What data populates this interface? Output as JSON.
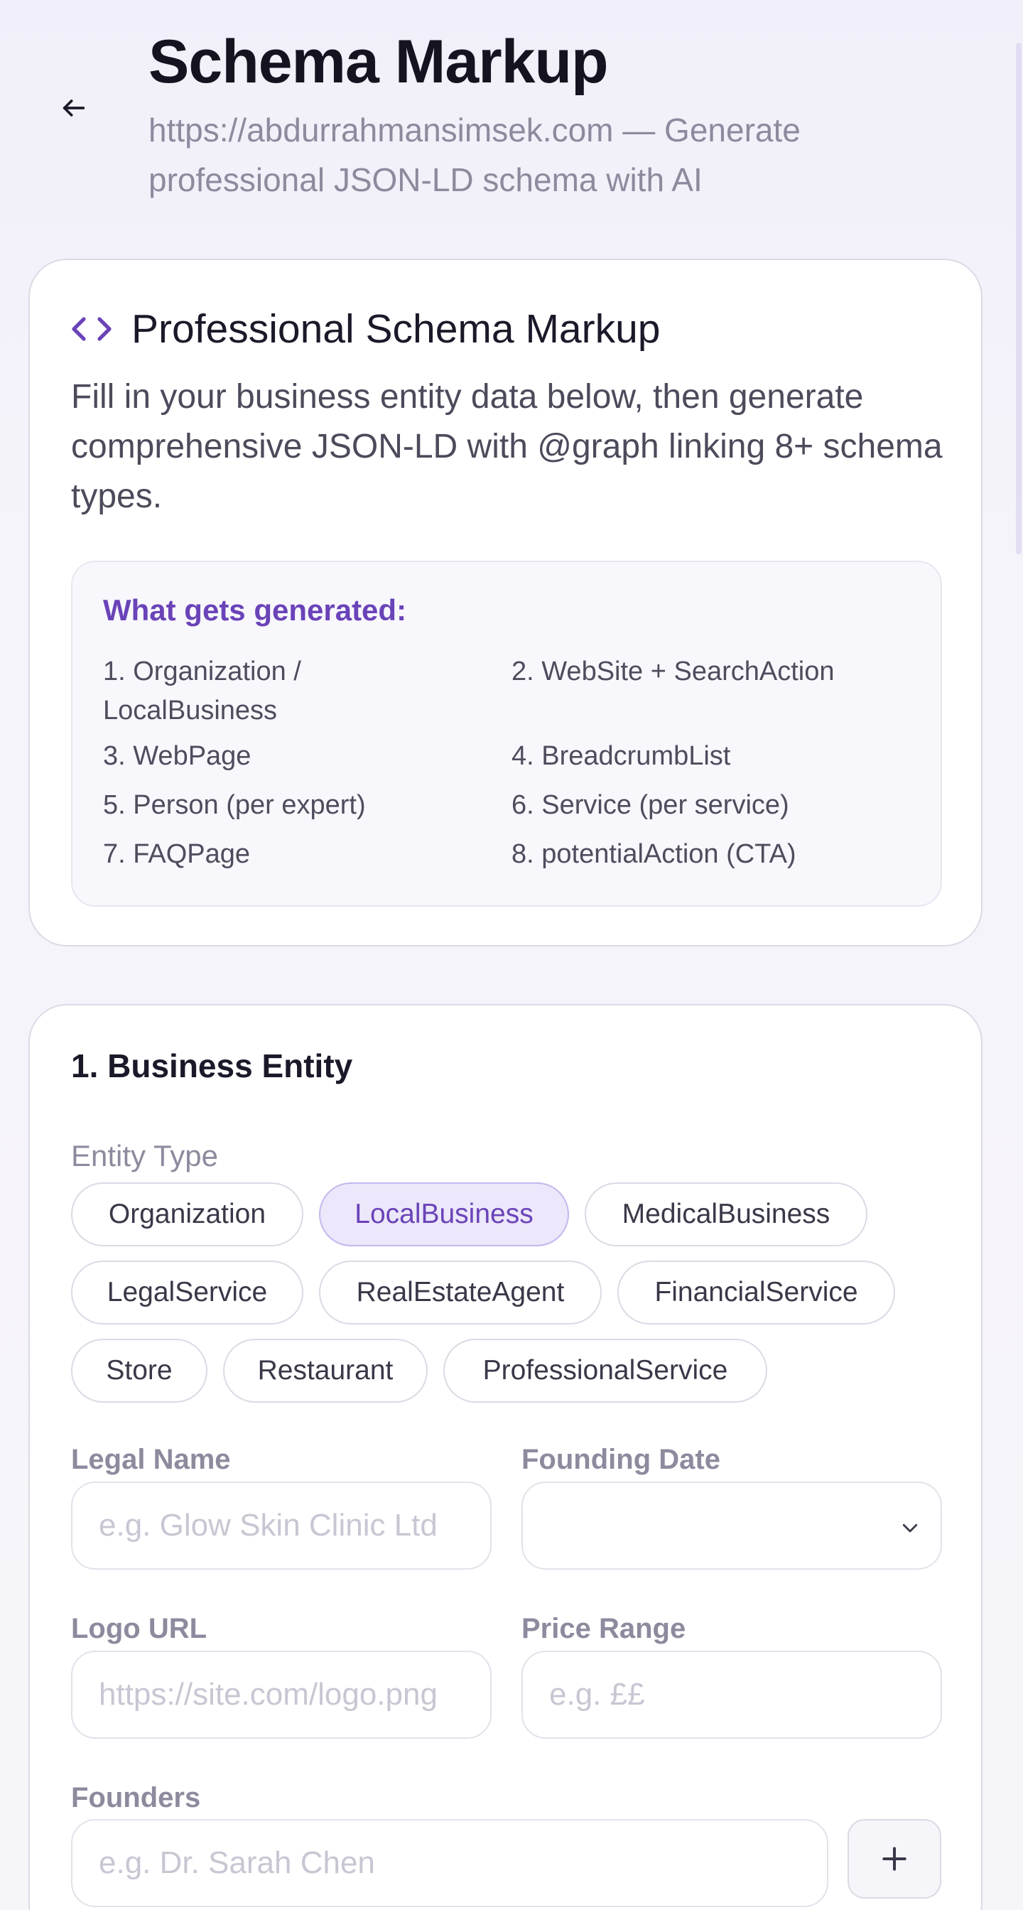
{
  "header": {
    "title": "Schema Markup",
    "subtitle": "https://abdurrahmansimsek.com — Generate professional JSON-LD schema with AI"
  },
  "intro": {
    "title": "Professional Schema Markup",
    "description": "Fill in your business entity data below, then generate comprehensive JSON-LD with @graph linking 8+ schema types.",
    "generated_heading": "What gets generated:",
    "generated_items": [
      "1. Organization / LocalBusiness",
      "2. WebSite + SearchAction",
      "3. WebPage",
      "4. BreadcrumbList",
      "5. Person (per expert)",
      "6. Service (per service)",
      "7. FAQPage",
      "8. potentialAction (CTA)"
    ]
  },
  "entity": {
    "section_title": "1. Business Entity",
    "entity_type_label": "Entity Type",
    "entity_types": [
      "Organization",
      "LocalBusiness",
      "MedicalBusiness",
      "LegalService",
      "RealEstateAgent",
      "FinancialService",
      "Store",
      "Restaurant",
      "ProfessionalService"
    ],
    "selected_entity_type": "LocalBusiness",
    "legal_name": {
      "label": "Legal Name",
      "value": "",
      "placeholder": "e.g. Glow Skin Clinic Ltd"
    },
    "founding_date": {
      "label": "Founding Date",
      "value": ""
    },
    "logo_url": {
      "label": "Logo URL",
      "value": "",
      "placeholder": "https://site.com/logo.png"
    },
    "price_range": {
      "label": "Price Range",
      "value": "",
      "placeholder": "e.g. ££"
    },
    "founders": {
      "label": "Founders",
      "value": "",
      "placeholder": "e.g. Dr. Sarah Chen"
    }
  },
  "colors": {
    "accent": "#6a43b8",
    "chip_selected_bg": "#ece7fa",
    "card_border": "#dcdae5",
    "muted_text": "#8e8a9e"
  },
  "icons": {
    "back": "arrow-left-icon",
    "intro": "code-icon",
    "select": "chevron-down-icon",
    "add": "plus-icon"
  }
}
